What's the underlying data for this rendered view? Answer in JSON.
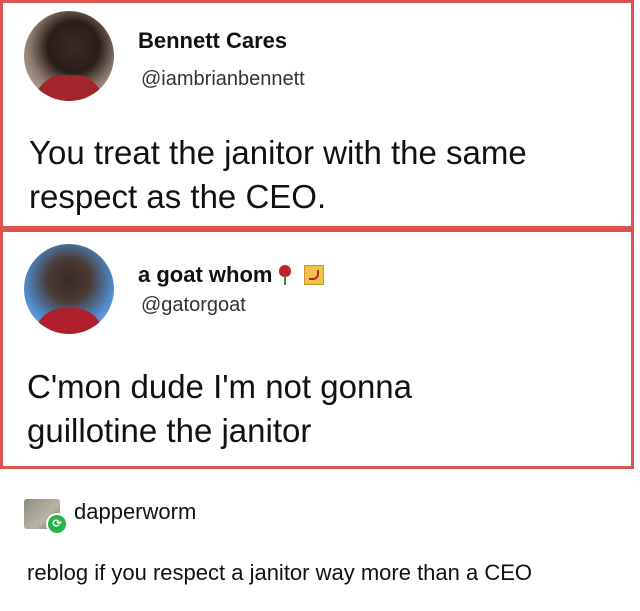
{
  "tweets": [
    {
      "display_name": "Bennett Cares",
      "handle": "@iambrianbennett",
      "text": "You treat the janitor with the same\nrespect as the CEO."
    },
    {
      "display_name": "a goat whom",
      "handle": "@gatorgoat",
      "text": "C'mon dude I'm not gonna\nguillotine the janitor",
      "name_icons": [
        "rose-icon",
        "hammer-and-sickle-flag-icon"
      ]
    }
  ],
  "reblog": {
    "username": "dapperworm",
    "text": "reblog if you respect a janitor way more than a CEO",
    "badge_icon": "reblog-icon"
  },
  "colors": {
    "card_border": "#d9534f",
    "reblog_badge": "#28b34b"
  }
}
